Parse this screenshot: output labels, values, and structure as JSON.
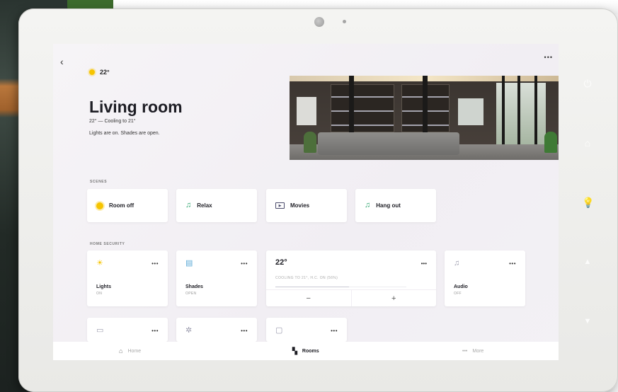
{
  "screen": {
    "weather_temp": "22°",
    "room_title": "Living room",
    "room_status": "22° — Cooling to 21°",
    "room_status_2": "Lights are on. Shades are open.",
    "more_label": "•••"
  },
  "scenes": {
    "section_label": "SCENES",
    "items": [
      {
        "label": "Room off",
        "icon": "sun-icon"
      },
      {
        "label": "Relax",
        "icon": "music-icon"
      },
      {
        "label": "Movies",
        "icon": "movie-icon"
      },
      {
        "label": "Hang out",
        "icon": "music-icon"
      }
    ]
  },
  "security": {
    "section_label": "HOME SECURITY",
    "tiles": [
      {
        "name": "Lights",
        "state": "ON",
        "icon": "lightbulb-icon"
      },
      {
        "name": "Shades",
        "state": "OPEN",
        "icon": "shades-icon"
      },
      {
        "name": "Audio",
        "state": "OFF",
        "icon": "audio-icon"
      }
    ],
    "thermostat": {
      "temp": "22°",
      "description": "COOLING TO 21°, H.C. ON (56%)",
      "humidity_fraction": 0.56,
      "minus": "−",
      "plus": "+"
    },
    "more_label": "•••"
  },
  "extra_tiles": [
    {
      "icon": "tv-icon"
    },
    {
      "icon": "fan-icon"
    },
    {
      "icon": "window-icon"
    }
  ],
  "nav": {
    "home": "Home",
    "rooms": "Rooms",
    "more": "More",
    "more_dots": "•••"
  },
  "colors": {
    "accent_yellow": "#f6c400",
    "accent_green": "#2ea56e",
    "text_dark": "#1d1d24"
  }
}
